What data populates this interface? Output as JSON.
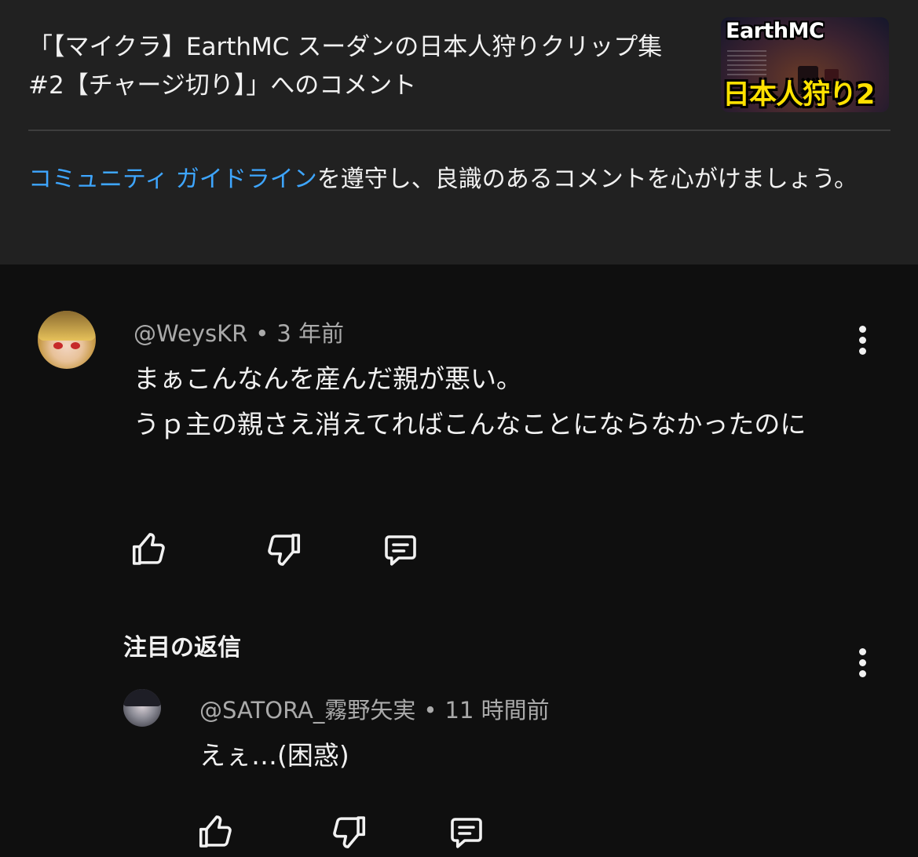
{
  "header": {
    "title": "「【マイクラ】EarthMC スーダンの日本人狩りクリップ集 #2【チャージ切り】」へのコメント",
    "thumbnail": {
      "top_text": "EarthMC",
      "bottom_text": "日本人狩り2"
    },
    "guideline": {
      "link_text": "コミュニティ ガイドライン",
      "rest_text": "を遵守し、良識のあるコメントを心がけましょう。"
    }
  },
  "comment": {
    "author": "@WeysKR",
    "separator": "•",
    "time": "3 年前",
    "text": "まぁこんなんを産んだ親が悪い。\nうｐ主の親さえ消えてればこんなことにならなかったのに",
    "actions": [
      "like-icon",
      "dislike-icon",
      "reply-icon"
    ]
  },
  "highlighted_reply": {
    "section_label": "注目の返信",
    "author": "@SATORA_霧野矢実",
    "separator": "•",
    "time": "11 時間前",
    "text": "えぇ…(困惑)",
    "actions": [
      "like-icon",
      "dislike-icon",
      "reply-icon"
    ]
  },
  "colors": {
    "header_bg": "#212121",
    "page_bg": "#0f0f0f",
    "link": "#3ea6ff",
    "secondary_text": "#aaaaaa"
  }
}
